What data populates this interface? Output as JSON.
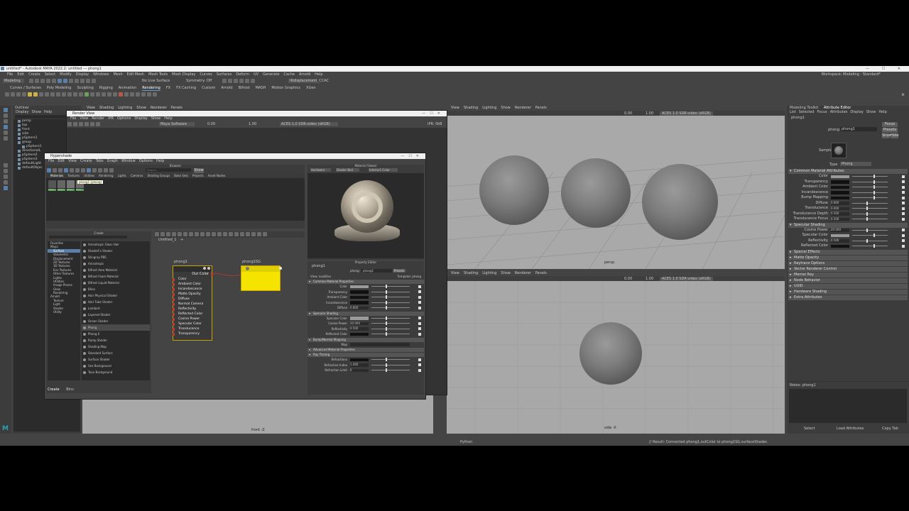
{
  "window_title": "untitled* - Autodesk MAYA 2022.2: untitled   ---   phong1",
  "menu": [
    "File",
    "Edit",
    "Create",
    "Select",
    "Modify",
    "Display",
    "Windows",
    "Mesh",
    "Edit Mesh",
    "Mesh Tools",
    "Mesh Display",
    "Curves",
    "Surfaces",
    "Deform",
    "UV",
    "Generate",
    "Cache",
    "Arnold",
    "Help"
  ],
  "workspace": "Workspace: Modeling - Standard*",
  "module_dropdown": "Modeling",
  "live_surface": "No Live Surface",
  "symmetry": "Symmetry: Off",
  "render_layer": "IRdisplacement_CCAC",
  "shelf_tabs": [
    "Curves / Surfaces",
    "Poly Modeling",
    "Sculpting",
    "Rigging",
    "Animation",
    "Rendering",
    "FX",
    "FX Caching",
    "Custom",
    "Arnold",
    "Bifrost",
    "MASH",
    "Motion Graphics",
    "XGen"
  ],
  "active_shelf": "Rendering",
  "outliner": {
    "title": "Outliner",
    "menu": [
      "Display",
      "Show",
      "Help"
    ],
    "items": [
      "persp",
      "top",
      "front",
      "side",
      "pSphere1",
      "group",
      "pSphere1",
      "directionalL",
      "pSphere2",
      "pSphere3",
      "defaultLight",
      "defaultObjec"
    ]
  },
  "viewport_menu": [
    "View",
    "Shading",
    "Lighting",
    "Show",
    "Renderer",
    "Panels"
  ],
  "viewport_values": {
    "exposure": "0.00",
    "gamma": "1.00",
    "colorspace": "ACES 1.0 SDR-video (sRGB)"
  },
  "viewport_label_persp": "persp",
  "viewport_label_bottom": "side -X",
  "viewport_label_left": "front -Z",
  "render_view": {
    "title": "Render View",
    "menu": [
      "File",
      "View",
      "Render",
      "IPR",
      "Options",
      "Display",
      "Show",
      "Help"
    ],
    "renderer": "Maya Software",
    "exposure": "0.00",
    "gamma": "1.00",
    "colorspace": "ACES 1.0 SDR-video (sRGB)",
    "ipr": "IPR: 0kB"
  },
  "hypershade": {
    "title": "Hypershade",
    "menu": [
      "File",
      "Edit",
      "View",
      "Create",
      "Tabs",
      "Graph",
      "Window",
      "Options",
      "Help"
    ],
    "browser_label": "Browser",
    "search_placeholder": "Search...",
    "show_btn": "Show",
    "browser_tabs": [
      "Materials",
      "Textures",
      "Utilities",
      "Rendering",
      "Lights",
      "Cameras",
      "Shading Groups",
      "Bake Sets",
      "Projects",
      "Asset Nodes"
    ],
    "tooltip": "phong1 (phong)",
    "swatch_labels": [
      "lamb",
      "stand",
      "phon",
      "Phon"
    ],
    "material_viewer": {
      "label": "Material Viewer",
      "renderer": "Hardware",
      "shape": "Shader Ball",
      "env": "Interior1 Color"
    },
    "create_label": "Create",
    "create_tree": [
      "Favorites",
      "Maya",
      "Surface",
      "Volumetric",
      "Displacement",
      "2D Textures",
      "3D Textures",
      "Env Textures",
      "Other Textures",
      "Lights",
      "Utilities",
      "Image Planes",
      "Glow",
      "Rendering",
      "Arnold",
      "Texture",
      "Light",
      "Shader",
      "Utility"
    ],
    "create_list": [
      "Anisotropic Glass Hair",
      "ShaderFx Shader",
      "Stingray PBS",
      "Anisotropic",
      "Bifrost Aero Material",
      "Bifrost Foam Material",
      "Bifrost Liquid Material",
      "Blinn",
      "Hair Physical Shader",
      "Hair Tube Shader",
      "Lambert",
      "Layered Shader",
      "Ocean Shader",
      "Phong",
      "Phong E",
      "Ramp Shader",
      "Shading Map",
      "Standard Surface",
      "Surface Shader",
      "Use Background",
      "Toon Background"
    ],
    "bottom_tabs": [
      "Create",
      "Bins"
    ],
    "graph_tab": "Untitled_1",
    "node_phong": {
      "name": "phong1",
      "out": "Out Color",
      "ports": [
        "Color",
        "Ambient Color",
        "Incandescence",
        "Matte Opacity",
        "Diffuse",
        "Normal Camera",
        "Reflectivity",
        "Reflected Color",
        "Cosine Power",
        "Specular Color",
        "Translucence",
        "Transparency"
      ]
    },
    "node_sg": {
      "name": "phong1SG"
    },
    "property_editor": {
      "title": "Property Editor",
      "node_label": "phong1",
      "field_label": "phong:",
      "field_value": "phong1",
      "presets": "Presets",
      "view": "View: LookDev",
      "template": "Template: phong",
      "sections": [
        "Common Material Properties",
        "Specular Shading",
        "Bump/Normal Mapping",
        "Advanced Material Properties",
        "Ray Tracing"
      ],
      "common": [
        {
          "label": "Color",
          "value": ""
        },
        {
          "label": "Transparency",
          "value": ""
        },
        {
          "label": "Ambient Color",
          "value": ""
        },
        {
          "label": "Incandescence",
          "value": ""
        },
        {
          "label": "Diffuse",
          "value": "0.800"
        }
      ],
      "specular": [
        {
          "label": "Specular Color",
          "value": ""
        },
        {
          "label": "Cosine Power",
          "value": "20.000"
        },
        {
          "label": "Reflectivity",
          "value": "0.500"
        },
        {
          "label": "Reflected Color",
          "value": ""
        }
      ],
      "bump_map": "Map",
      "raytracing": [
        {
          "label": "Refractions",
          "value": ""
        },
        {
          "label": "Refractive Index",
          "value": "1.000"
        },
        {
          "label": "Refraction Limit",
          "value": "6"
        }
      ]
    }
  },
  "attribute_editor": {
    "tabs": [
      "Modeling Toolkit",
      "Attribute Editor"
    ],
    "menu": [
      "List",
      "Selected",
      "Focus",
      "Attributes",
      "Display",
      "Show",
      "Help"
    ],
    "node_tab": "phong1",
    "field_label": "phong:",
    "field_value": "phong1",
    "focus": "Focus",
    "presets": "Presets",
    "show": "Show",
    "hide": "Hide",
    "sample": "Sample",
    "type_label": "Type",
    "type_value": "Phong",
    "sections": [
      "Common Material Attributes",
      "Specular Shading",
      "Special Effects",
      "Matte Opacity",
      "Raytrace Options",
      "Vector Renderer Control",
      "Mental Ray",
      "Node Behavior",
      "UUID",
      "Hardware Shading",
      "Extra Attributes"
    ],
    "common": [
      {
        "label": "Color",
        "value": ""
      },
      {
        "label": "Transparency",
        "value": ""
      },
      {
        "label": "Ambient Color",
        "value": ""
      },
      {
        "label": "Incandescence",
        "value": ""
      },
      {
        "label": "Bump Mapping",
        "value": ""
      },
      {
        "label": "Diffuse",
        "value": "0.800"
      },
      {
        "label": "Translucence",
        "value": "0.000"
      },
      {
        "label": "Translucence Depth",
        "value": "0.500"
      },
      {
        "label": "Translucence Focus",
        "value": "0.500"
      }
    ],
    "specular": [
      {
        "label": "Cosine Power",
        "value": "20.000"
      },
      {
        "label": "Specular Color",
        "value": ""
      },
      {
        "label": "Reflectivity",
        "value": "0.500"
      },
      {
        "label": "Reflected Color",
        "value": ""
      }
    ],
    "notes": "Notes:  phong1",
    "buttons": [
      "Select",
      "Load Attributes",
      "Copy Tab"
    ]
  },
  "status": {
    "python": "Python",
    "result": "// Result: Connected phong1.outColor to phong1SG.surfaceShader."
  }
}
